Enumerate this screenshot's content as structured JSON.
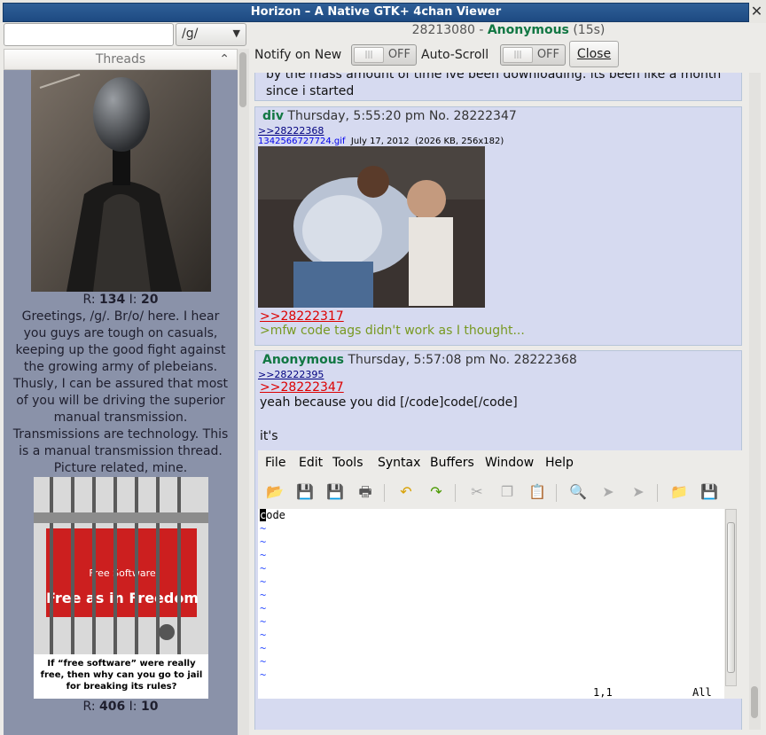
{
  "window": {
    "title": "Horizon – A Native GTK+ 4chan Viewer",
    "close_glyph": "✕"
  },
  "sidebar": {
    "search_value": "",
    "board": "/g/",
    "threads_label": "Threads",
    "threads": [
      {
        "r_label": "R:",
        "replies": "134",
        "i_label": "I:",
        "images": "20",
        "text": "Greetings, /g/. Br/o/ here. I hear you guys are tough on casuals, keeping up the good fight against the growing army of plebeians. Thusly, I can be assured that most of you will be driving the superior manual transmission. Transmissions are technology. This is a manual transmission thread. Picture related, mine."
      },
      {
        "r_label": "R:",
        "replies": "406",
        "i_label": "I:",
        "images": "10",
        "image_text_top": "Free as in Freedom",
        "image_text_small": "Free Software",
        "image_caption": "If “free software” were really free, then why can you go to jail for breaking its rules?"
      }
    ]
  },
  "thread_header": {
    "thread_id": "28213080",
    "sep": " - ",
    "name": "Anonymous",
    "age": "(15s)"
  },
  "toolbar": {
    "notify_label": "Notify on New",
    "notify_state": "OFF",
    "autoscroll_label": "Auto-Scroll",
    "autoscroll_state": "OFF",
    "close_label": "Close"
  },
  "posts": [
    {
      "text_line1": "by the mass amount of time ive been downloading. its been like a month",
      "text_line2": "since i started"
    },
    {
      "name": "div",
      "date": "Thursday, 5:55:20 pm",
      "no": "No. 28222347",
      "backlink": ">>28222368",
      "file_name": "1342566727724.gif",
      "file_date": "July 17, 2012",
      "file_meta": "(2026 KB, 256x182)",
      "quote": ">>28222317",
      "greentext": ">mfw code tags didn't work as I thought..."
    },
    {
      "name": "Anonymous",
      "date": "Thursday, 5:57:08 pm",
      "no": "No. 28222368",
      "backlink": ">>28222395",
      "quote": ">>28222347",
      "text": "yeah because you did [/code]code[/code]",
      "text2": "it's"
    }
  ],
  "gvim": {
    "menu": [
      "File",
      "Edit",
      "Tools",
      "Syntax",
      "Buffers",
      "Window",
      "Help"
    ],
    "first_char": "c",
    "first_rest": "ode",
    "tilde": "~",
    "pos": "1,1",
    "scroll": "All"
  }
}
